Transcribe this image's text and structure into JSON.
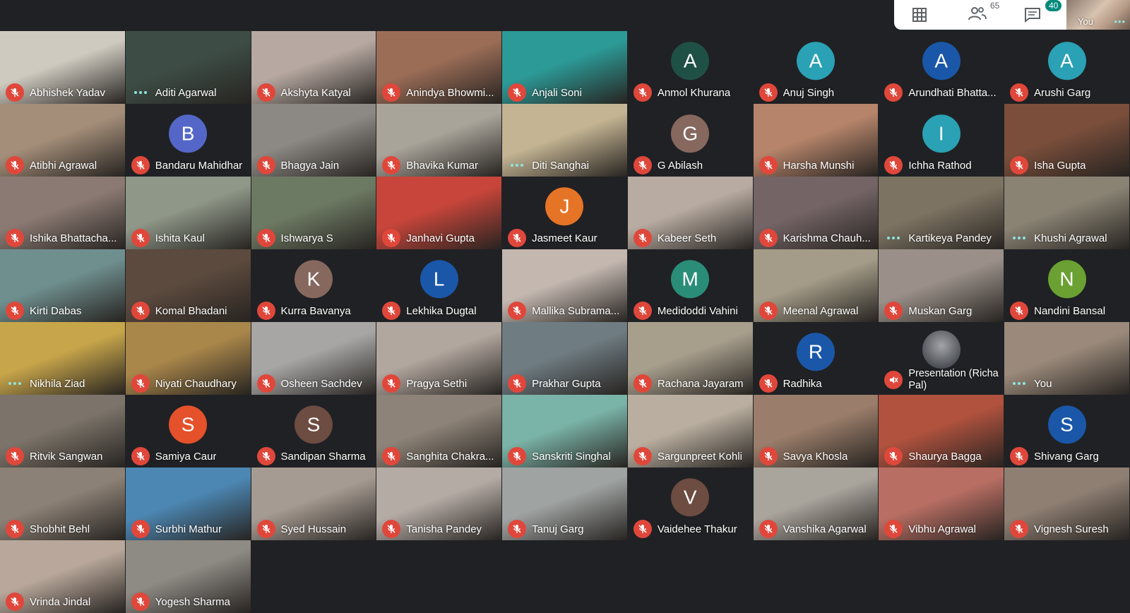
{
  "topbar": {
    "participants_count": "65",
    "chat_badge": "40",
    "self_label": "You"
  },
  "colors": {
    "mic_off": "#e0473b",
    "speaking_dots": "#8ee5e0",
    "tile_dark": "#202124"
  },
  "tiles": [
    {
      "name": "Abhishek Yadav",
      "status": "muted",
      "type": "video",
      "bg": "#cfcac0"
    },
    {
      "name": "Aditi Agarwal",
      "status": "dots",
      "type": "video",
      "bg": "#3d4d45"
    },
    {
      "name": "Akshyta Katyal",
      "status": "muted",
      "type": "video",
      "bg": "#b7a9a2"
    },
    {
      "name": "Anindya Bhowmi...",
      "status": "muted",
      "type": "video",
      "bg": "#9b6d57"
    },
    {
      "name": "Anjali Soni",
      "status": "muted",
      "type": "video",
      "bg": "#2c9a97"
    },
    {
      "name": "Anmol Khurana",
      "status": "muted",
      "type": "avatar",
      "letter": "A",
      "color": "#1f5045"
    },
    {
      "name": "Anuj Singh",
      "status": "muted",
      "type": "avatar",
      "letter": "A",
      "color": "#2aa1b4"
    },
    {
      "name": "Arundhati Bhatta...",
      "status": "muted",
      "type": "avatar",
      "letter": "A",
      "color": "#1a57a8"
    },
    {
      "name": "Arushi Garg",
      "status": "muted",
      "type": "avatar",
      "letter": "A",
      "color": "#2aa1b4"
    },
    {
      "name": "Atibhi Agrawal",
      "status": "muted",
      "type": "video",
      "bg": "#a48e79"
    },
    {
      "name": "Bandaru Mahidhar",
      "status": "muted",
      "type": "avatar",
      "letter": "B",
      "color": "#5467c8"
    },
    {
      "name": "Bhagya Jain",
      "status": "muted",
      "type": "video",
      "bg": "#8c8984"
    },
    {
      "name": "Bhavika Kumar",
      "status": "muted",
      "type": "video",
      "bg": "#a9a49a"
    },
    {
      "name": "Diti Sanghai",
      "status": "dots",
      "type": "video",
      "bg": "#c4b493"
    },
    {
      "name": "G Abilash",
      "status": "muted",
      "type": "avatar",
      "letter": "G",
      "color": "#86685f"
    },
    {
      "name": "Harsha Munshi",
      "status": "muted",
      "type": "video",
      "bg": "#b5846a"
    },
    {
      "name": "Ichha Rathod",
      "status": "muted",
      "type": "avatar",
      "letter": "I",
      "color": "#2aa1b4"
    },
    {
      "name": "Isha Gupta",
      "status": "muted",
      "type": "video",
      "bg": "#7a4e3b"
    },
    {
      "name": "Ishika Bhattacha...",
      "status": "muted",
      "type": "video",
      "bg": "#8b7a73"
    },
    {
      "name": "Ishita Kaul",
      "status": "muted",
      "type": "video",
      "bg": "#8e9788"
    },
    {
      "name": "Ishwarya S",
      "status": "muted",
      "type": "video",
      "bg": "#6d7a63"
    },
    {
      "name": "Janhavi Gupta",
      "status": "muted",
      "type": "video",
      "bg": "#c7453a"
    },
    {
      "name": "Jasmeet Kaur",
      "status": "muted",
      "type": "avatar",
      "letter": "J",
      "color": "#e67426"
    },
    {
      "name": "Kabeer Seth",
      "status": "muted",
      "type": "video",
      "bg": "#b8aba1"
    },
    {
      "name": "Karishma Chauh...",
      "status": "muted",
      "type": "video",
      "bg": "#746466"
    },
    {
      "name": "Kartikeya Pandey",
      "status": "dots",
      "type": "video",
      "bg": "#7d7362"
    },
    {
      "name": "Khushi Agrawal",
      "status": "dots",
      "type": "video",
      "bg": "#8a8374"
    },
    {
      "name": "Kirti Dabas",
      "status": "muted",
      "type": "video",
      "bg": "#6f8f8f"
    },
    {
      "name": "Komal Bhadani",
      "status": "muted",
      "type": "video",
      "bg": "#5c4a3e"
    },
    {
      "name": "Kurra Bavanya",
      "status": "muted",
      "type": "avatar",
      "letter": "K",
      "color": "#86685f"
    },
    {
      "name": "Lekhika Dugtal",
      "status": "muted",
      "type": "avatar",
      "letter": "L",
      "color": "#1a57a8"
    },
    {
      "name": "Mallika Subrama...",
      "status": "muted",
      "type": "video",
      "bg": "#c3b7b0"
    },
    {
      "name": "Medidoddi Vahini",
      "status": "muted",
      "type": "avatar",
      "letter": "M",
      "color": "#2a8d78"
    },
    {
      "name": "Meenal Agrawal",
      "status": "muted",
      "type": "video",
      "bg": "#a49c88"
    },
    {
      "name": "Muskan Garg",
      "status": "muted",
      "type": "video",
      "bg": "#9a9089"
    },
    {
      "name": "Nandini Bansal",
      "status": "muted",
      "type": "avatar",
      "letter": "N",
      "color": "#6aa132"
    },
    {
      "name": "Nikhila Ziad",
      "status": "dots",
      "type": "video",
      "bg": "#c7a54a"
    },
    {
      "name": "Niyati Chaudhary",
      "status": "muted",
      "type": "video",
      "bg": "#a9864a"
    },
    {
      "name": "Osheen Sachdev",
      "status": "muted",
      "type": "video",
      "bg": "#a8a6a5"
    },
    {
      "name": "Pragya Sethi",
      "status": "muted",
      "type": "video",
      "bg": "#b2a79f"
    },
    {
      "name": "Prakhar Gupta",
      "status": "muted",
      "type": "video",
      "bg": "#6f7c82"
    },
    {
      "name": "Rachana Jayaram",
      "status": "muted",
      "type": "video",
      "bg": "#a79e8c"
    },
    {
      "name": "Radhika",
      "status": "muted",
      "type": "avatar",
      "letter": "R",
      "color": "#1a57a8"
    },
    {
      "name": "Presentation (Richa Pal)",
      "status": "presenting",
      "type": "presentation"
    },
    {
      "name": "You",
      "status": "dots",
      "type": "video",
      "bg": "#9b8a7b"
    },
    {
      "name": "Ritvik Sangwan",
      "status": "muted",
      "type": "video",
      "bg": "#7c746a"
    },
    {
      "name": "Samiya Caur",
      "status": "muted",
      "type": "avatar",
      "letter": "S",
      "color": "#e4512b"
    },
    {
      "name": "Sandipan Sharma",
      "status": "muted",
      "type": "avatar",
      "letter": "S",
      "color": "#6d4c41"
    },
    {
      "name": "Sanghita Chakra...",
      "status": "muted",
      "type": "video",
      "bg": "#8d8378"
    },
    {
      "name": "Sanskriti Singhal",
      "status": "muted",
      "type": "video",
      "bg": "#7ab3a7"
    },
    {
      "name": "Sargunpreet Kohli",
      "status": "muted",
      "type": "video",
      "bg": "#b9ae9f"
    },
    {
      "name": "Savya Khosla",
      "status": "muted",
      "type": "video",
      "bg": "#9a7d6a"
    },
    {
      "name": "Shaurya Bagga",
      "status": "muted",
      "type": "video",
      "bg": "#b0523e"
    },
    {
      "name": "Shivang Garg",
      "status": "muted",
      "type": "avatar",
      "letter": "S",
      "color": "#1a57a8"
    },
    {
      "name": "Shobhit Behl",
      "status": "muted",
      "type": "video",
      "bg": "#8c8176"
    },
    {
      "name": "Surbhi Mathur",
      "status": "muted",
      "type": "video",
      "bg": "#4c87b3"
    },
    {
      "name": "Syed Hussain",
      "status": "muted",
      "type": "video",
      "bg": "#a69b92"
    },
    {
      "name": "Tanisha Pandey",
      "status": "muted",
      "type": "video",
      "bg": "#b5aba5"
    },
    {
      "name": "Tanuj Garg",
      "status": "muted",
      "type": "video",
      "bg": "#9fa3a2"
    },
    {
      "name": "Vaidehee Thakur",
      "status": "muted",
      "type": "avatar",
      "letter": "V",
      "color": "#6d4c41"
    },
    {
      "name": "Vanshika Agarwal",
      "status": "muted",
      "type": "video",
      "bg": "#a9a49c"
    },
    {
      "name": "Vibhu Agrawal",
      "status": "muted",
      "type": "video",
      "bg": "#b86e63"
    },
    {
      "name": "Vignesh Suresh",
      "status": "muted",
      "type": "video",
      "bg": "#8f7f73"
    },
    {
      "name": "Vrinda Jindal",
      "status": "muted",
      "type": "video",
      "bg": "#b8a79a"
    },
    {
      "name": "Yogesh Sharma",
      "status": "muted",
      "type": "video",
      "bg": "#8e8a84"
    }
  ]
}
